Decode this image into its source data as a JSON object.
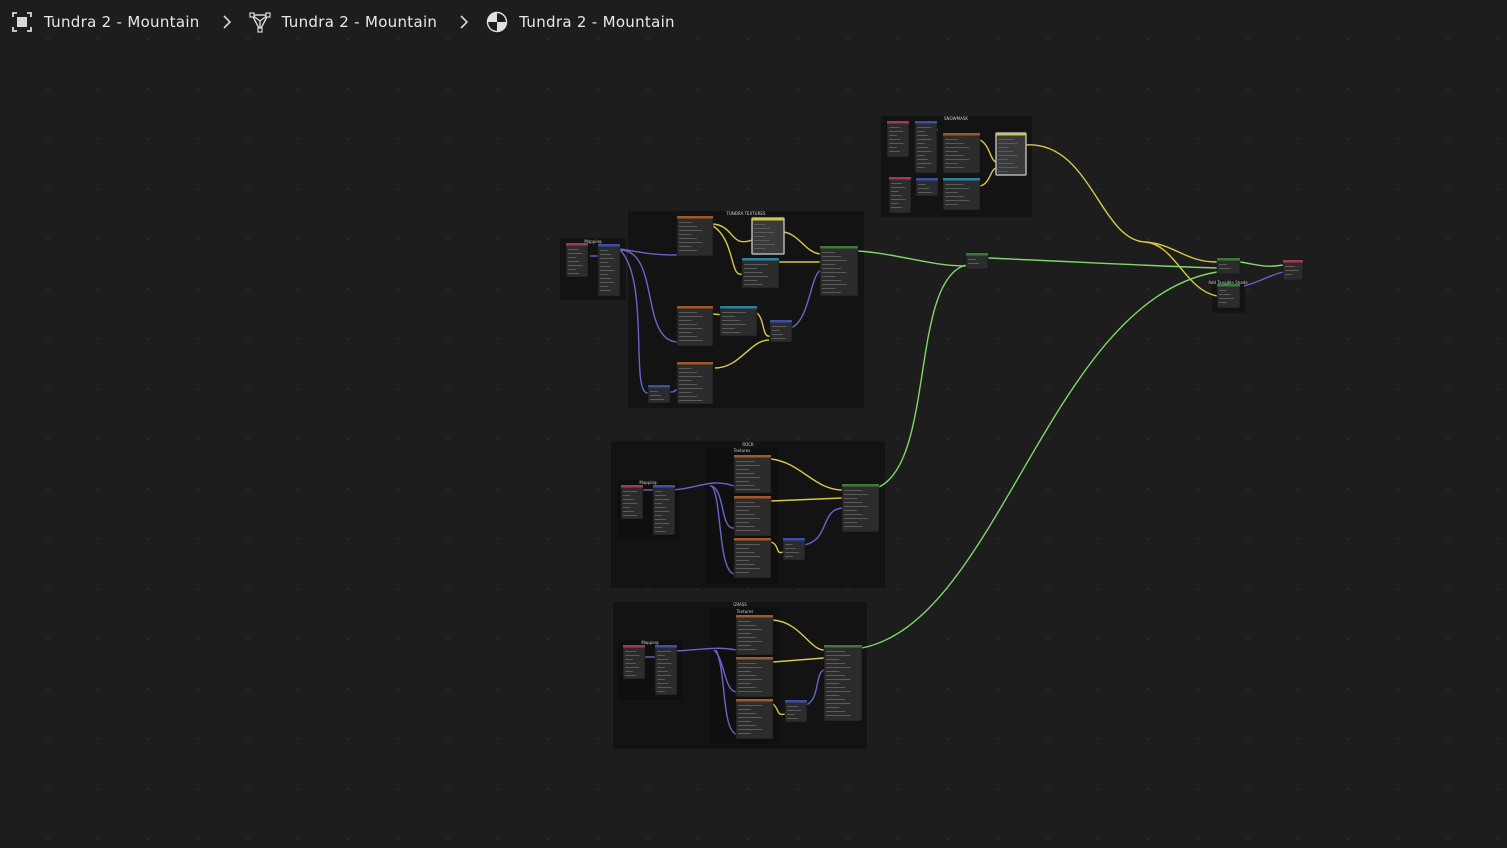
{
  "breadcrumb": [
    {
      "label": "Tundra 2 - Mountain",
      "icon": "object-icon"
    },
    {
      "label": "Tundra 2 - Mountain",
      "icon": "mesh-icon"
    },
    {
      "label": "Tundra 2 - Mountain",
      "icon": "material-icon"
    }
  ],
  "frames": {
    "snowmask": "SNOWMASK",
    "tundra_textures": "TUNDRA TEXTURES",
    "rock": "ROCK",
    "grass": "GRASS",
    "textures": "Textures",
    "mapping": "Mapping",
    "mix_shader": "Add Tangible Shade"
  },
  "colors": {
    "wire_yellow": "#d6c84a",
    "wire_green": "#7fd66a",
    "wire_purple": "#6b63c9",
    "header_orange": "#a5562a",
    "header_green": "#3a7a3a",
    "header_red": "#a33a4e",
    "header_blue": "#3b4ea8",
    "header_teal": "#2b7f9e"
  }
}
